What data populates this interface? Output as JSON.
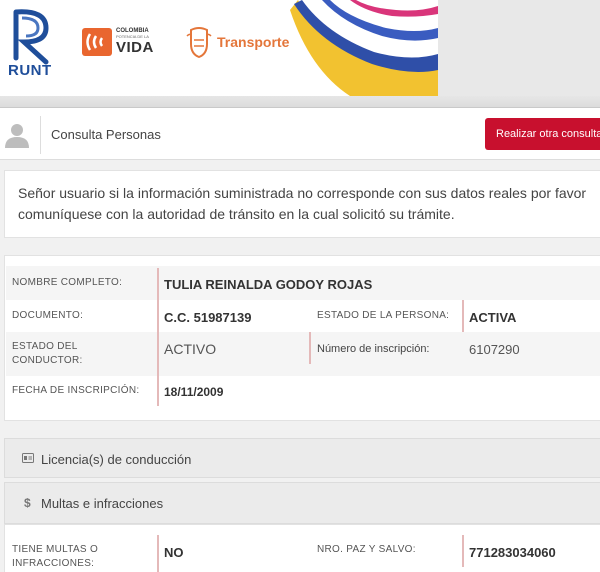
{
  "logos": {
    "runt": "RUNT",
    "colombia_line1": "COLOMBIA",
    "colombia_line2": "POTENCIA DE LA",
    "colombia_line3": "VIDA",
    "transporte": "Transporte"
  },
  "header": {
    "title": "Consulta Personas",
    "action_button": "Realizar otra consulta"
  },
  "notice": {
    "line1": "Señor usuario si la información suministrada no corresponde con sus datos reales por favor",
    "line2": "comuníquese con la autoridad de tránsito en la cual solicitó su trámite."
  },
  "person": {
    "nombre_label": "NOMBRE COMPLETO:",
    "nombre_value": "TULIA REINALDA GODOY ROJAS",
    "documento_label": "DOCUMENTO:",
    "documento_value": "C.C. 51987139",
    "estado_persona_label": "ESTADO DE LA PERSONA:",
    "estado_persona_value": "ACTIVA",
    "estado_conductor_label_1": "ESTADO DEL",
    "estado_conductor_label_2": "CONDUCTOR:",
    "estado_conductor_value": "ACTIVO",
    "inscripcion_num_label": "Número de inscripción:",
    "inscripcion_num_value": "6107290",
    "fecha_label": "FECHA DE INSCRIPCIÓN:",
    "fecha_value": "18/11/2009"
  },
  "sections": {
    "licencias": "Licencia(s) de conducción",
    "multas": "Multas e infracciones",
    "licencias_icon": "id-card-icon",
    "multas_icon": "dollar-icon"
  },
  "multas": {
    "tiene_label_1": "TIENE MULTAS O",
    "tiene_label_2": "INFRACCIONES:",
    "tiene_value": "NO",
    "paz_label": "NRO. PAZ Y SALVO:",
    "paz_value": "771283034060"
  },
  "colors": {
    "accent_red": "#c8102e",
    "runt_blue": "#1f4e9a",
    "transporte_orange": "#e4763a",
    "separator_pink": "#e4b9b9"
  }
}
